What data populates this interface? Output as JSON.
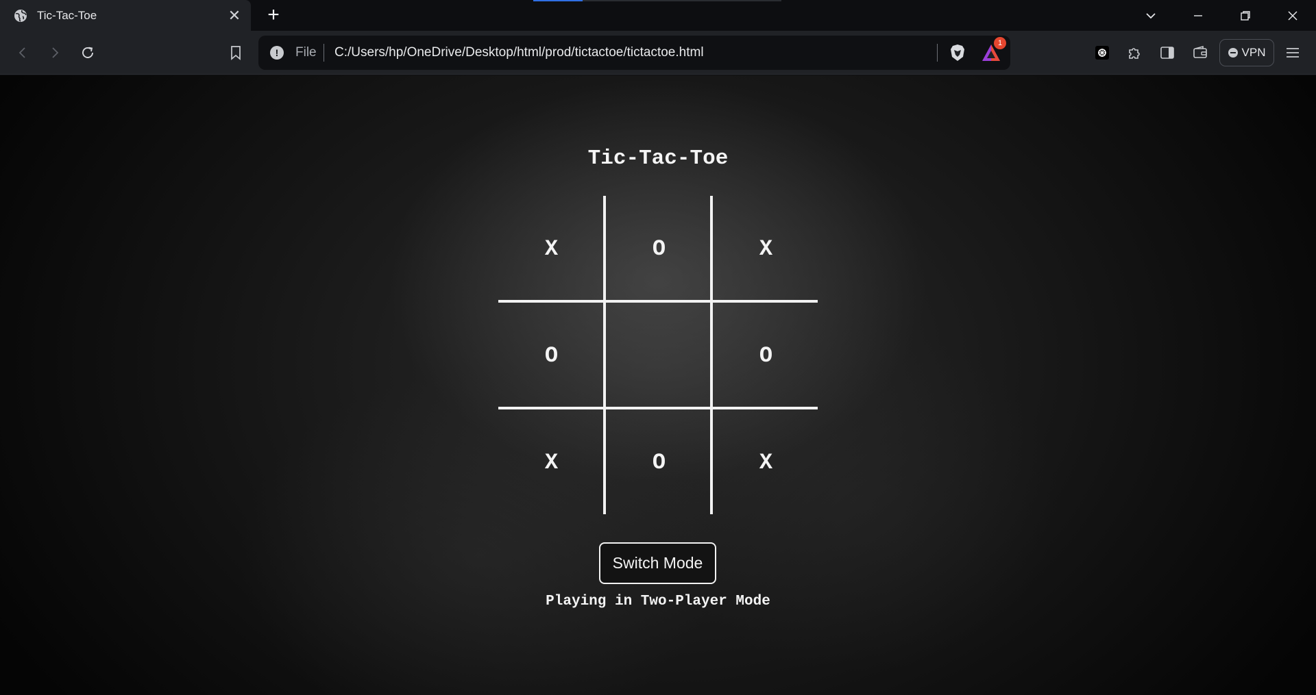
{
  "browser": {
    "tab_title": "Tic-Tac-Toe",
    "tab_close": "✕",
    "new_tab": "+",
    "address_scheme": "File",
    "address_url": "C:/Users/hp/OneDrive/Desktop/html/prod/tictactoe/tictactoe.html",
    "rewards_badge": "1",
    "vpn_label": "VPN"
  },
  "game": {
    "title": "Tic-Tac-Toe",
    "cells": [
      "X",
      "O",
      "X",
      "O",
      "",
      "O",
      "X",
      "O",
      "X"
    ],
    "switch_button": "Switch Mode",
    "status": "Playing in Two-Player Mode"
  }
}
